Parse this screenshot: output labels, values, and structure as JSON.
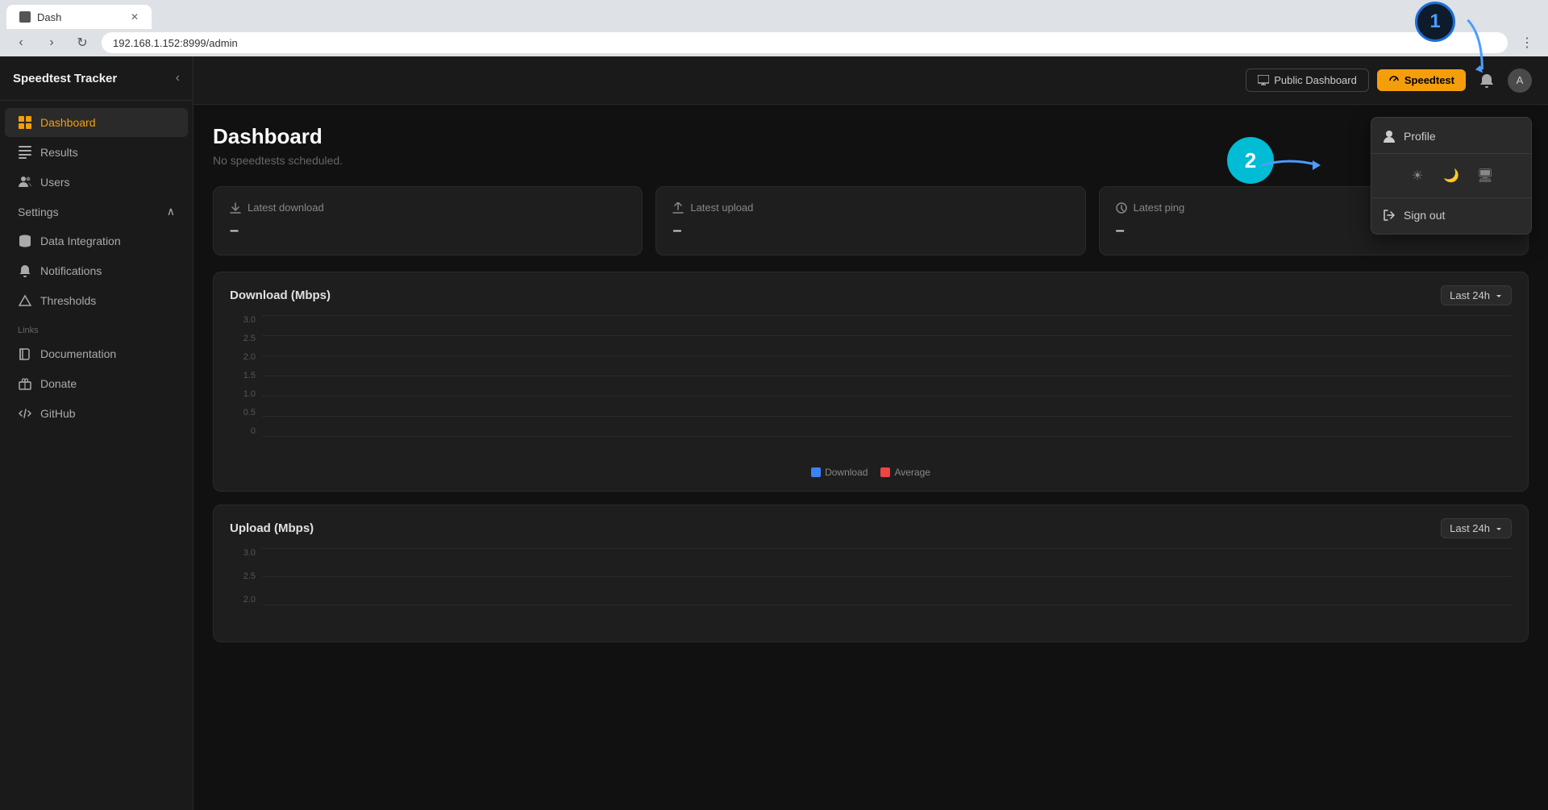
{
  "browser": {
    "tab_title": "Dash",
    "address": "192.168.1.152:8999/admin",
    "nav_back": "‹",
    "nav_forward": "›",
    "nav_reload": "↻"
  },
  "app": {
    "title": "Speedtest Tracker"
  },
  "sidebar": {
    "items": [
      {
        "id": "dashboard",
        "label": "Dashboard",
        "icon": "chart",
        "active": true
      },
      {
        "id": "results",
        "label": "Results",
        "icon": "table",
        "active": false
      },
      {
        "id": "users",
        "label": "Users",
        "icon": "users",
        "active": false
      }
    ],
    "settings_label": "Settings",
    "settings_items": [
      {
        "id": "data-integration",
        "label": "Data Integration",
        "icon": "database"
      },
      {
        "id": "notifications",
        "label": "Notifications",
        "icon": "bell"
      },
      {
        "id": "thresholds",
        "label": "Thresholds",
        "icon": "triangle"
      }
    ],
    "links_label": "Links",
    "links_items": [
      {
        "id": "documentation",
        "label": "Documentation",
        "icon": "book"
      },
      {
        "id": "donate",
        "label": "Donate",
        "icon": "gift"
      },
      {
        "id": "github",
        "label": "GitHub",
        "icon": "code"
      }
    ]
  },
  "topbar": {
    "public_dashboard_label": "Public Dashboard",
    "speedtest_label": "Speedtest",
    "notification_icon": "🔔",
    "avatar_label": "A"
  },
  "page": {
    "title": "Dashboard",
    "subtitle": "No speedtests scheduled."
  },
  "stats": [
    {
      "label": "Latest download",
      "value": "–",
      "icon": "download"
    },
    {
      "label": "Latest upload",
      "value": "–",
      "icon": "upload"
    },
    {
      "label": "Latest ping",
      "value": "–",
      "icon": "clock"
    }
  ],
  "charts": [
    {
      "title": "Download (Mbps)",
      "time_range": "Last 24h",
      "y_labels": [
        "3.0",
        "2.5",
        "2.0",
        "1.5",
        "1.0",
        "0.5",
        "0"
      ],
      "legend": [
        {
          "label": "Download",
          "color": "#3b82f6"
        },
        {
          "label": "Average",
          "color": "#ef4444"
        }
      ]
    },
    {
      "title": "Upload (Mbps)",
      "time_range": "Last 24h",
      "y_labels": [
        "3.0",
        "2.5",
        "2.0"
      ],
      "legend": []
    }
  ],
  "profile_dropdown": {
    "profile_label": "Profile",
    "sign_out_label": "Sign out",
    "theme_options": [
      "☀",
      "🌙",
      "🖥"
    ]
  },
  "annotations": {
    "circle_1": "1",
    "circle_2": "2"
  }
}
